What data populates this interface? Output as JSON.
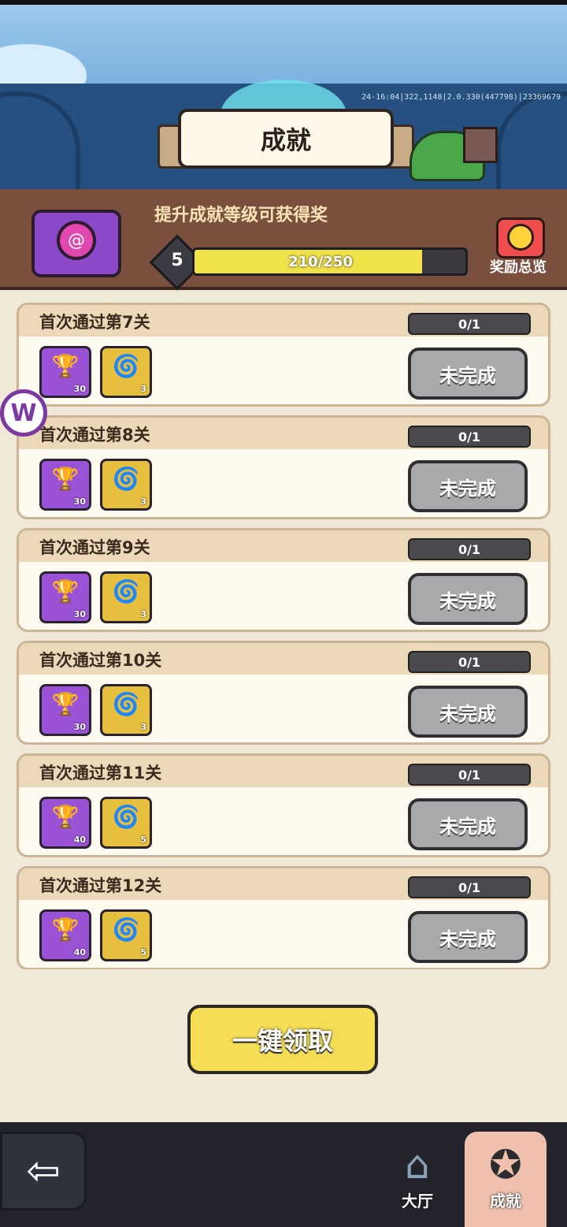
{
  "debug_text": "24-16:04|322,1148|2.0.330(447798)|23369679",
  "page_title": "成就",
  "header": {
    "subtitle": "提升成就等级可获得奖",
    "level": "5",
    "progress_text": "210/250",
    "progress_fraction": 0.84,
    "rewards_overview_label": "奖励总览"
  },
  "achievements": [
    {
      "title": "首次通过第7关",
      "count": "0/1",
      "reward_purple_qty": "30",
      "reward_gold_qty": "3",
      "status": "未完成"
    },
    {
      "title": "首次通过第8关",
      "count": "0/1",
      "reward_purple_qty": "30",
      "reward_gold_qty": "3",
      "status": "未完成"
    },
    {
      "title": "首次通过第9关",
      "count": "0/1",
      "reward_purple_qty": "30",
      "reward_gold_qty": "3",
      "status": "未完成"
    },
    {
      "title": "首次通过第10关",
      "count": "0/1",
      "reward_purple_qty": "30",
      "reward_gold_qty": "3",
      "status": "未完成"
    },
    {
      "title": "首次通过第11关",
      "count": "0/1",
      "reward_purple_qty": "40",
      "reward_gold_qty": "5",
      "status": "未完成"
    },
    {
      "title": "首次通过第12关",
      "count": "0/1",
      "reward_purple_qty": "40",
      "reward_gold_qty": "5",
      "status": "未完成"
    }
  ],
  "claim_all_label": "一键领取",
  "nav": {
    "hall_label": "大厅",
    "achievement_label": "成就"
  },
  "colors": {
    "accent_yellow": "#f5de55",
    "purple": "#9a52d6",
    "gold": "#e7bf3e",
    "disabled_button": "#a9a9ab"
  }
}
